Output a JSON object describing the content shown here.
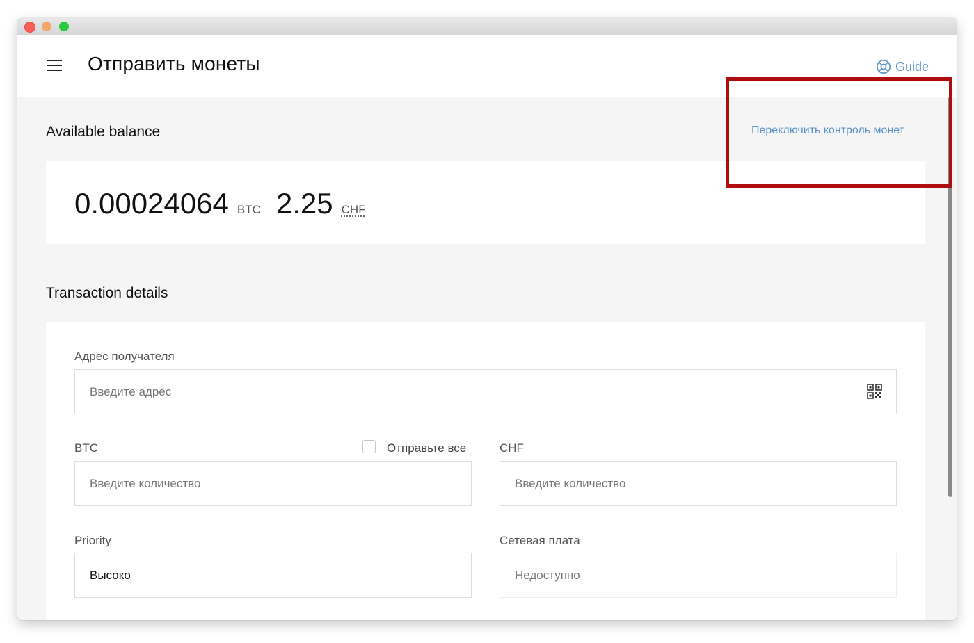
{
  "header": {
    "title": "Отправить монеты",
    "guide_label": "Guide"
  },
  "balance": {
    "section_title": "Available balance",
    "coin_control_link": "Переключить контроль монет",
    "btc_amount": "0.00024064",
    "btc_unit": "BTC",
    "fiat_amount": "2.25",
    "fiat_unit": "CHF"
  },
  "transaction": {
    "section_title": "Transaction details",
    "recipient_label": "Адрес получателя",
    "recipient_placeholder": "Введите адрес",
    "btc_label": "BTC",
    "send_all_label": "Отправьте все",
    "btc_placeholder": "Введите количество",
    "fiat_label": "CHF",
    "fiat_placeholder": "Введите количество",
    "priority_label": "Priority",
    "priority_value": "Высоко",
    "fee_label": "Сетевая плата",
    "fee_value": "Недоступно"
  },
  "colors": {
    "accent": "#5a91c9",
    "highlight": "#b00e0e"
  }
}
